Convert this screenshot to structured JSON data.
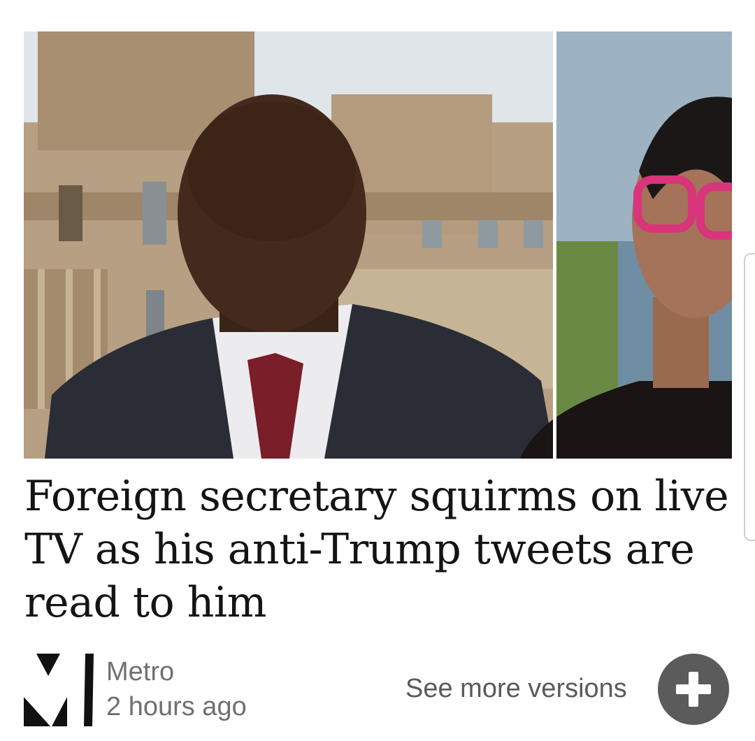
{
  "article": {
    "headline": "Foreign secretary squirms on live TV as his anti-Trump tweets are read to him",
    "image_description_icon": "news-photo"
  },
  "source": {
    "name": "Metro",
    "time": "2 hours ago",
    "logo_icon": "metro-logo-icon"
  },
  "actions": {
    "see_more_label": "See more versions",
    "plus_icon": "plus-icon"
  },
  "colors": {
    "headline": "#141414",
    "meta_text": "#707070",
    "action_text": "#5a5a5a",
    "plus_button_bg": "#5b5b5b"
  }
}
